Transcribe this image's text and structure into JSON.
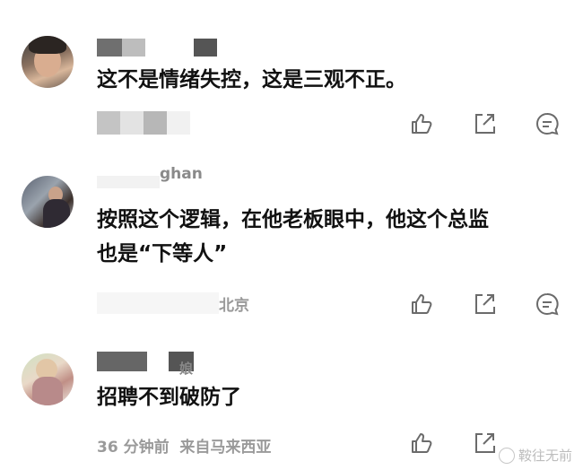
{
  "comments": [
    {
      "text": "这不是情绪失控，这是三观不正。",
      "meta": ""
    },
    {
      "username_fragment": "ghan",
      "text_line1": "按照这个逻辑，在他老板眼中，他这个总监",
      "text_line2": "也是“下等人”",
      "meta": "北京"
    },
    {
      "username_fragment": "娘",
      "text": "招聘不到破防了",
      "meta": "36 分钟前  来自马来西亚"
    }
  ],
  "actions": {
    "like_icon": "thumbs-up-icon",
    "share_icon": "share-icon",
    "reply_icon": "comment-icon"
  },
  "watermark": "鞍往无前"
}
